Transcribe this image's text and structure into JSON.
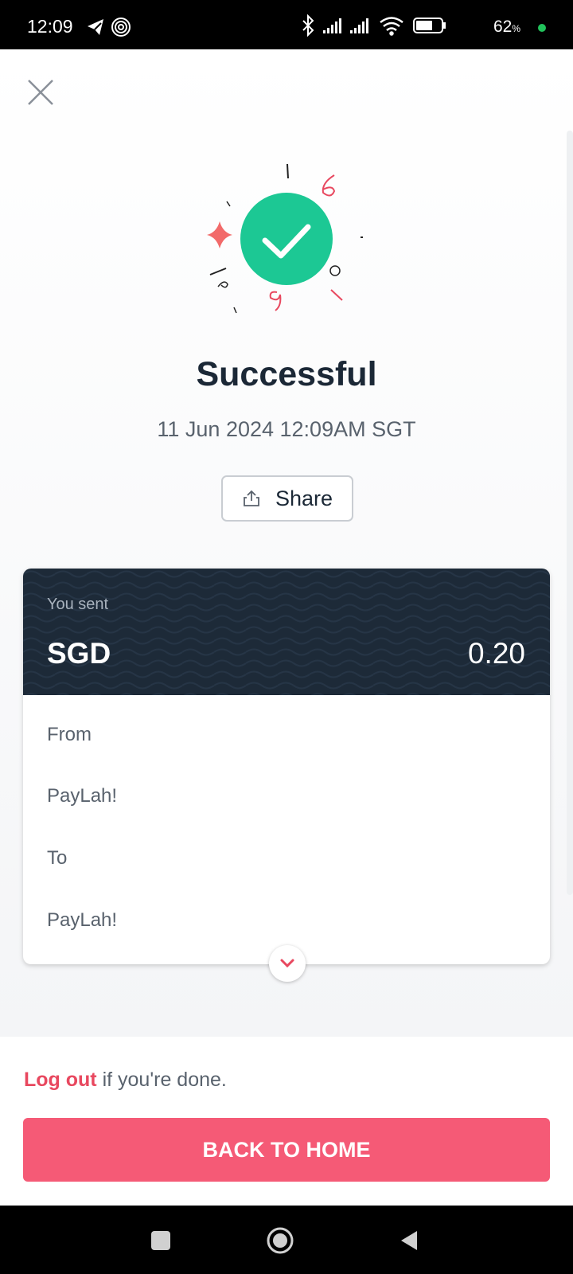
{
  "status_bar": {
    "time": "12:09",
    "battery_level": "62",
    "battery_unit": "%"
  },
  "receipt": {
    "title": "Successful",
    "datetime": "11 Jun 2024 12:09AM SGT",
    "share_label": "Share"
  },
  "card": {
    "you_sent_label": "You sent",
    "currency": "SGD",
    "amount": "0.20",
    "from_label": "From",
    "from_value": "PayLah!",
    "to_label": "To",
    "to_value": "PayLah!"
  },
  "footer": {
    "logout_label": "Log out",
    "logout_suffix": " if you're done.",
    "home_button_label": "BACK TO HOME"
  },
  "colors": {
    "success_green": "#1cc894",
    "accent_red": "#e8485f",
    "button_pink": "#f55a76",
    "card_dark": "#1d2a38"
  },
  "icons": [
    "telegram-icon",
    "hotspot-icon",
    "bluetooth-icon",
    "signal-icon",
    "wifi-icon",
    "battery-icon",
    "close-icon",
    "checkmark-icon",
    "sparkle-icon",
    "share-icon",
    "chevron-down-icon",
    "recents-icon",
    "home-icon",
    "back-icon"
  ]
}
